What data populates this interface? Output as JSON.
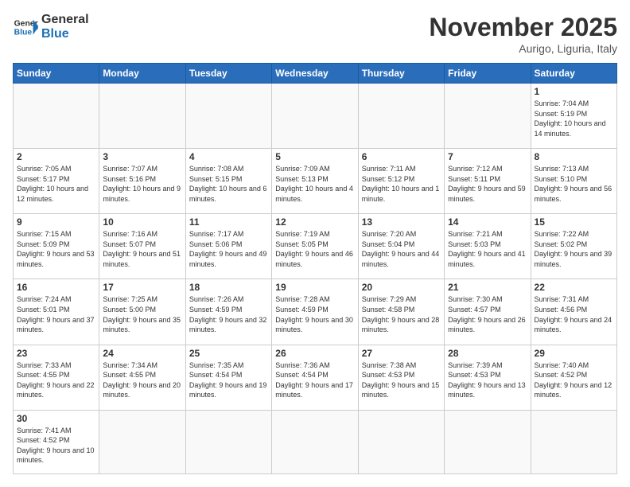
{
  "header": {
    "logo_general": "General",
    "logo_blue": "Blue",
    "month_title": "November 2025",
    "subtitle": "Aurigo, Liguria, Italy"
  },
  "days_of_week": [
    "Sunday",
    "Monday",
    "Tuesday",
    "Wednesday",
    "Thursday",
    "Friday",
    "Saturday"
  ],
  "weeks": [
    [
      {
        "day": "",
        "text": ""
      },
      {
        "day": "",
        "text": ""
      },
      {
        "day": "",
        "text": ""
      },
      {
        "day": "",
        "text": ""
      },
      {
        "day": "",
        "text": ""
      },
      {
        "day": "",
        "text": ""
      },
      {
        "day": "1",
        "text": "Sunrise: 7:04 AM\nSunset: 5:19 PM\nDaylight: 10 hours and 14 minutes."
      }
    ],
    [
      {
        "day": "2",
        "text": "Sunrise: 7:05 AM\nSunset: 5:17 PM\nDaylight: 10 hours and 12 minutes."
      },
      {
        "day": "3",
        "text": "Sunrise: 7:07 AM\nSunset: 5:16 PM\nDaylight: 10 hours and 9 minutes."
      },
      {
        "day": "4",
        "text": "Sunrise: 7:08 AM\nSunset: 5:15 PM\nDaylight: 10 hours and 6 minutes."
      },
      {
        "day": "5",
        "text": "Sunrise: 7:09 AM\nSunset: 5:13 PM\nDaylight: 10 hours and 4 minutes."
      },
      {
        "day": "6",
        "text": "Sunrise: 7:11 AM\nSunset: 5:12 PM\nDaylight: 10 hours and 1 minute."
      },
      {
        "day": "7",
        "text": "Sunrise: 7:12 AM\nSunset: 5:11 PM\nDaylight: 9 hours and 59 minutes."
      },
      {
        "day": "8",
        "text": "Sunrise: 7:13 AM\nSunset: 5:10 PM\nDaylight: 9 hours and 56 minutes."
      }
    ],
    [
      {
        "day": "9",
        "text": "Sunrise: 7:15 AM\nSunset: 5:09 PM\nDaylight: 9 hours and 53 minutes."
      },
      {
        "day": "10",
        "text": "Sunrise: 7:16 AM\nSunset: 5:07 PM\nDaylight: 9 hours and 51 minutes."
      },
      {
        "day": "11",
        "text": "Sunrise: 7:17 AM\nSunset: 5:06 PM\nDaylight: 9 hours and 49 minutes."
      },
      {
        "day": "12",
        "text": "Sunrise: 7:19 AM\nSunset: 5:05 PM\nDaylight: 9 hours and 46 minutes."
      },
      {
        "day": "13",
        "text": "Sunrise: 7:20 AM\nSunset: 5:04 PM\nDaylight: 9 hours and 44 minutes."
      },
      {
        "day": "14",
        "text": "Sunrise: 7:21 AM\nSunset: 5:03 PM\nDaylight: 9 hours and 41 minutes."
      },
      {
        "day": "15",
        "text": "Sunrise: 7:22 AM\nSunset: 5:02 PM\nDaylight: 9 hours and 39 minutes."
      }
    ],
    [
      {
        "day": "16",
        "text": "Sunrise: 7:24 AM\nSunset: 5:01 PM\nDaylight: 9 hours and 37 minutes."
      },
      {
        "day": "17",
        "text": "Sunrise: 7:25 AM\nSunset: 5:00 PM\nDaylight: 9 hours and 35 minutes."
      },
      {
        "day": "18",
        "text": "Sunrise: 7:26 AM\nSunset: 4:59 PM\nDaylight: 9 hours and 32 minutes."
      },
      {
        "day": "19",
        "text": "Sunrise: 7:28 AM\nSunset: 4:59 PM\nDaylight: 9 hours and 30 minutes."
      },
      {
        "day": "20",
        "text": "Sunrise: 7:29 AM\nSunset: 4:58 PM\nDaylight: 9 hours and 28 minutes."
      },
      {
        "day": "21",
        "text": "Sunrise: 7:30 AM\nSunset: 4:57 PM\nDaylight: 9 hours and 26 minutes."
      },
      {
        "day": "22",
        "text": "Sunrise: 7:31 AM\nSunset: 4:56 PM\nDaylight: 9 hours and 24 minutes."
      }
    ],
    [
      {
        "day": "23",
        "text": "Sunrise: 7:33 AM\nSunset: 4:55 PM\nDaylight: 9 hours and 22 minutes."
      },
      {
        "day": "24",
        "text": "Sunrise: 7:34 AM\nSunset: 4:55 PM\nDaylight: 9 hours and 20 minutes."
      },
      {
        "day": "25",
        "text": "Sunrise: 7:35 AM\nSunset: 4:54 PM\nDaylight: 9 hours and 19 minutes."
      },
      {
        "day": "26",
        "text": "Sunrise: 7:36 AM\nSunset: 4:54 PM\nDaylight: 9 hours and 17 minutes."
      },
      {
        "day": "27",
        "text": "Sunrise: 7:38 AM\nSunset: 4:53 PM\nDaylight: 9 hours and 15 minutes."
      },
      {
        "day": "28",
        "text": "Sunrise: 7:39 AM\nSunset: 4:53 PM\nDaylight: 9 hours and 13 minutes."
      },
      {
        "day": "29",
        "text": "Sunrise: 7:40 AM\nSunset: 4:52 PM\nDaylight: 9 hours and 12 minutes."
      }
    ],
    [
      {
        "day": "30",
        "text": "Sunrise: 7:41 AM\nSunset: 4:52 PM\nDaylight: 9 hours and 10 minutes."
      },
      {
        "day": "",
        "text": ""
      },
      {
        "day": "",
        "text": ""
      },
      {
        "day": "",
        "text": ""
      },
      {
        "day": "",
        "text": ""
      },
      {
        "day": "",
        "text": ""
      },
      {
        "day": "",
        "text": ""
      }
    ]
  ]
}
